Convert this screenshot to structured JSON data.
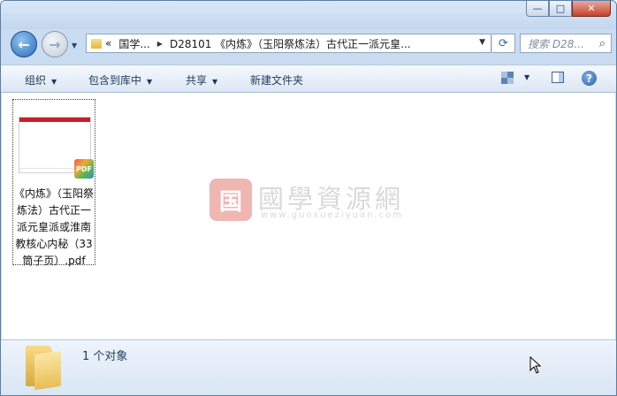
{
  "window": {
    "controls": {
      "minimize": "—",
      "maximize": "□",
      "close": "✕"
    }
  },
  "nav": {
    "back_icon": "back-arrow-icon",
    "forward_icon": "forward-arrow-icon",
    "address": {
      "prefix": "«",
      "crumb1": "国学...",
      "crumb2": "D28101 《内炼》（玉阳祭炼法）古代正一派元皇..."
    },
    "search_placeholder": "搜索 D28..."
  },
  "toolbar": {
    "organize": "组织",
    "include_library": "包含到库中",
    "share": "共享",
    "new_folder": "新建文件夹"
  },
  "file": {
    "name": "《内炼》（玉阳祭炼法）古代正一派元皇派或淮南教核心内秘（33筒子页）.pdf",
    "thumb_label": "PDF",
    "badge": "PDF"
  },
  "watermark": {
    "seal": "国",
    "title": "國學資源網",
    "url": "www.guoxueziyuan.com"
  },
  "status": {
    "count_text": "1 个对象"
  }
}
